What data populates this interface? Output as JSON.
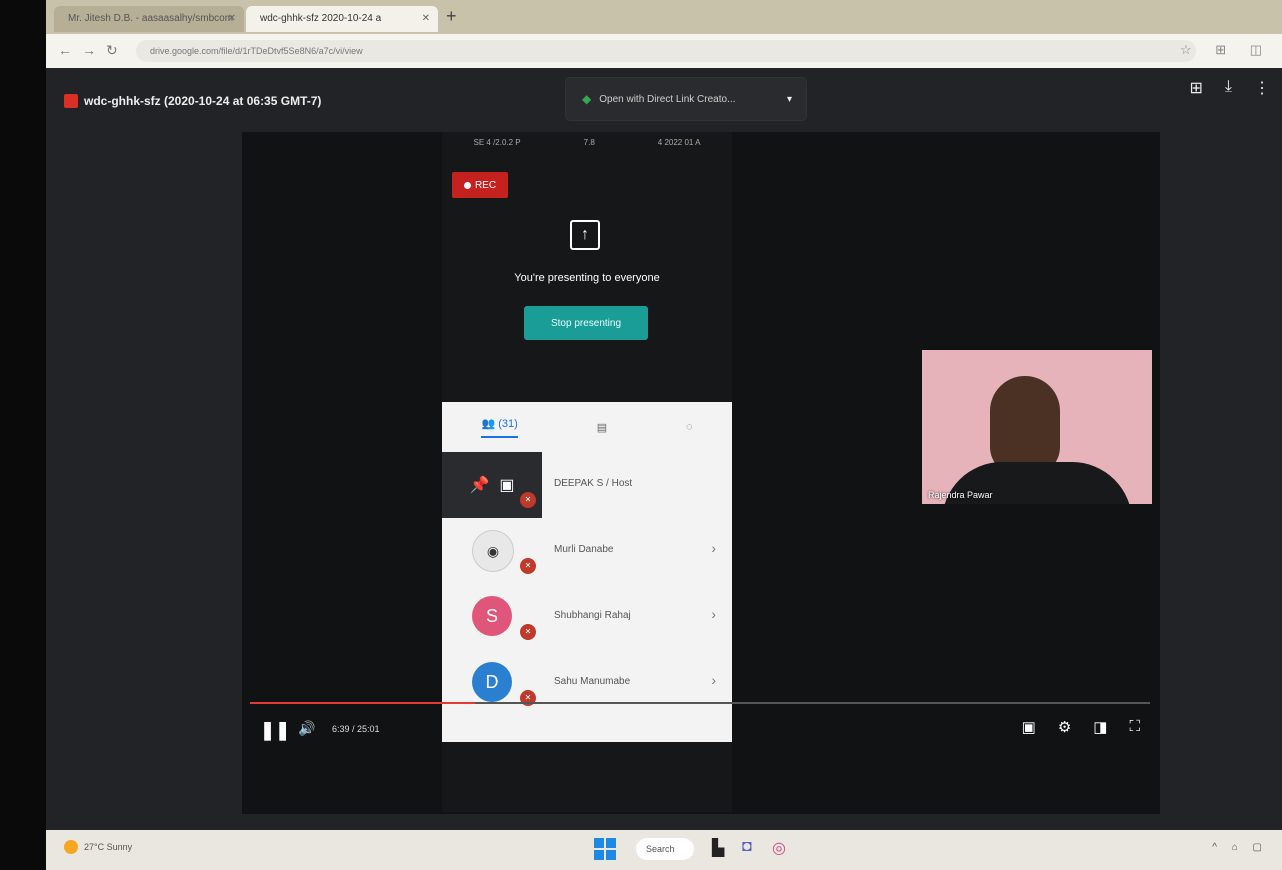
{
  "browser": {
    "tabs": [
      {
        "label": "Mr. Jitesh D.B. - aasaasalhy/smbcom"
      },
      {
        "label": "wdc-ghhk-sfz 2020-10-24 a"
      }
    ],
    "new_tab": "+",
    "url": "drive.google.com/file/d/1rTDeDtvf5Se8N6/a7c/vi/view"
  },
  "viewer": {
    "file_title": "wdc-ghhk-sfz (2020-10-24 at 06:35 GMT-7)",
    "open_with_label": "Open with Direct Link Creato...",
    "open_with_caret": "▾"
  },
  "player": {
    "meta": [
      "SE 4 /2.0.2 P",
      "7.8",
      "4 2022 01 A"
    ],
    "rec_label": "REC",
    "presenting_text": "You're presenting to everyone",
    "stop_button": "Stop presenting",
    "panel_tab_count": "(31)",
    "participants": [
      {
        "name": "DEEPAK S / Host",
        "initial": ""
      },
      {
        "name": "Murli Danabe",
        "initial": ""
      },
      {
        "name": "Shubhangi Rahaj",
        "initial": "S",
        "color": "#e0557a"
      },
      {
        "name": "Sahu Manumabe",
        "initial": "D",
        "color": "#2b7fd1"
      }
    ],
    "camera_name": "Rajendra Pawar",
    "time_display": "6:39 / 25:01",
    "progress": 0.25
  },
  "taskbar": {
    "weather": "27°C Sunny",
    "search": "Search"
  },
  "colors": {
    "rec": "#c5221f",
    "stop_button": "#1a9d97",
    "progress": "#e53935"
  }
}
